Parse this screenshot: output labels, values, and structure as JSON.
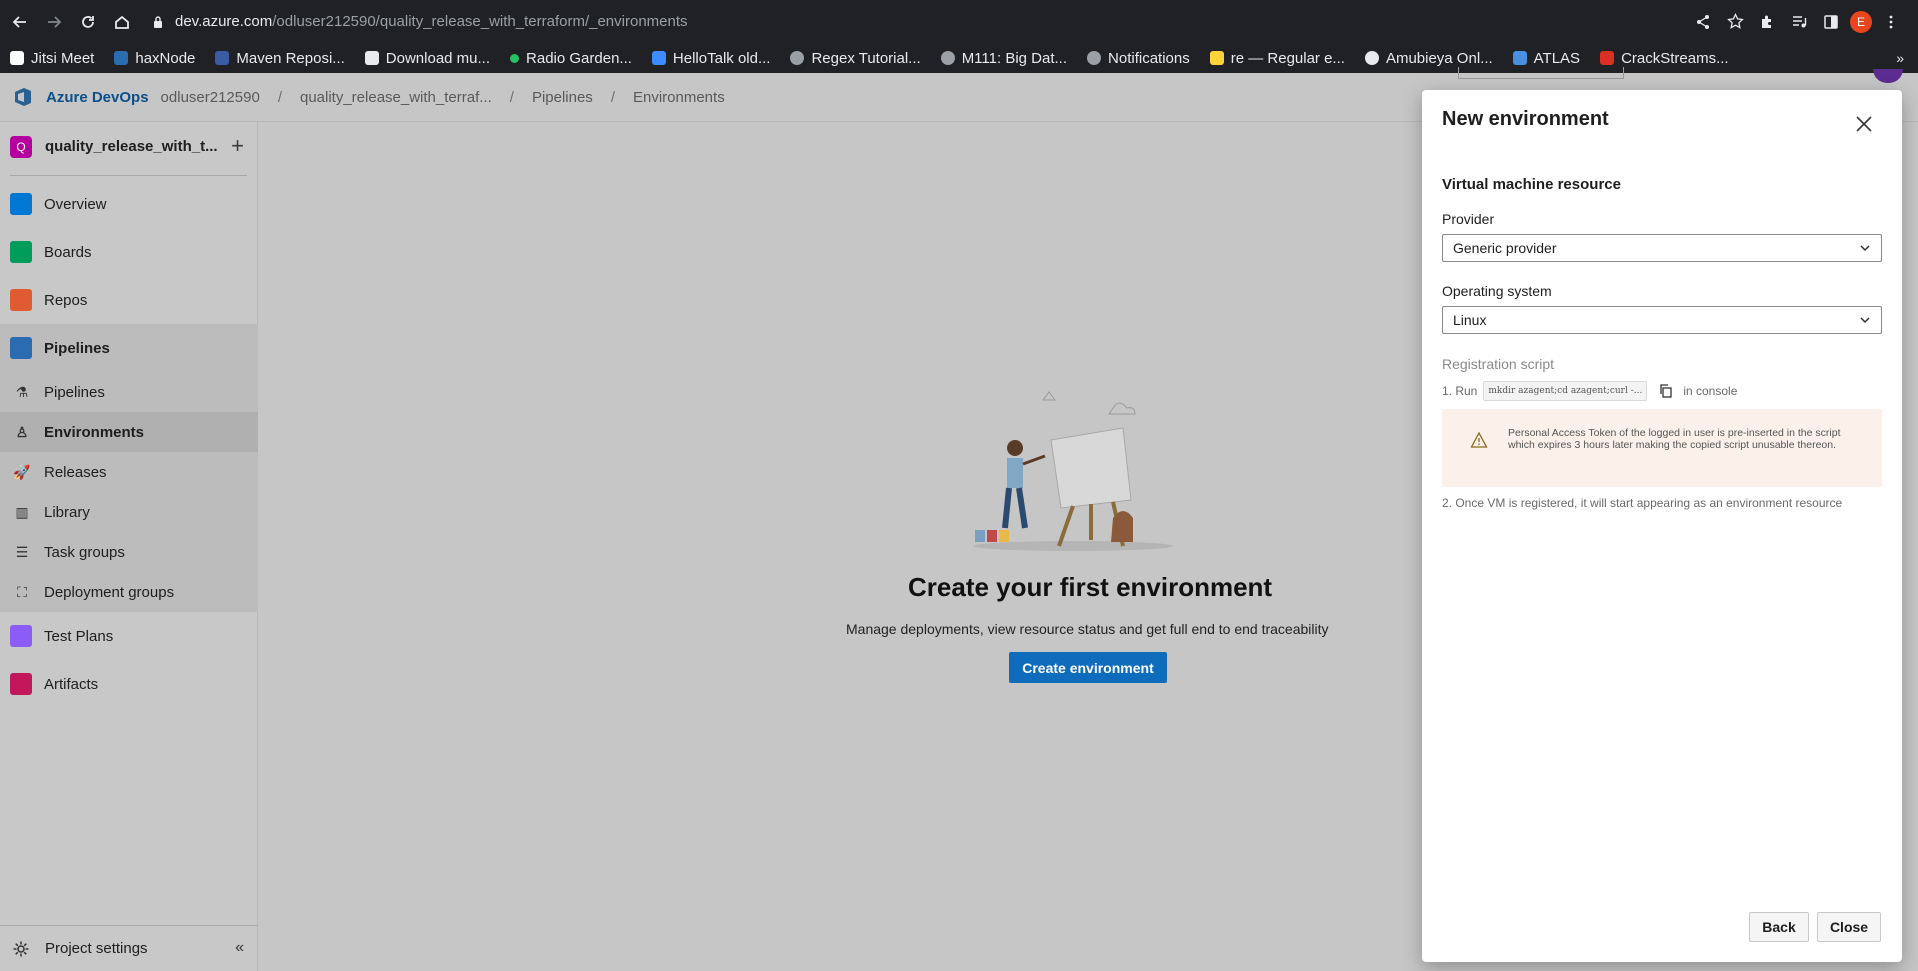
{
  "browser": {
    "url_host": "dev.azure.com",
    "url_path": "/odluser212590/quality_release_with_terraform/_environments",
    "profile_initial": "E",
    "bookmarks": [
      {
        "label": "Jitsi Meet",
        "color": "#ffffff"
      },
      {
        "label": "haxNode",
        "color": "#2b6cb0"
      },
      {
        "label": "Maven Reposi...",
        "color": "#3b5ba5"
      },
      {
        "label": "Download mu...",
        "color": "#e8eaed"
      },
      {
        "label": "Radio Garden...",
        "color": "#24c264"
      },
      {
        "label": "HelloTalk old...",
        "color": "#3d8bfd"
      },
      {
        "label": "Regex Tutorial...",
        "color": "#9aa0a6"
      },
      {
        "label": "M111: Big Dat...",
        "color": "#9aa0a6"
      },
      {
        "label": "Notifications",
        "color": "#9aa0a6"
      },
      {
        "label": "re — Regular e...",
        "color": "#ffd43b"
      },
      {
        "label": "Amubieya Onl...",
        "color": "#e8eaed"
      },
      {
        "label": "ATLAS",
        "color": "#4a90e2"
      },
      {
        "label": "CrackStreams...",
        "color": "#d93025"
      }
    ],
    "more_label": "»"
  },
  "topbar": {
    "brand": "Azure DevOps",
    "breadcrumbs": [
      "odluser212590",
      "quality_release_with_terraf...",
      "Pipelines",
      "Environments"
    ]
  },
  "sidebar": {
    "project_badge": "Q",
    "project_name": "quality_release_with_t...",
    "add_label": "+",
    "items": [
      {
        "label": "Overview",
        "icon": "overview-icon",
        "color": "#0078d4"
      },
      {
        "label": "Boards",
        "icon": "boards-icon",
        "color": "#009c5a"
      },
      {
        "label": "Repos",
        "icon": "repos-icon",
        "color": "#e05b31"
      }
    ],
    "pipelines_section": {
      "label": "Pipelines",
      "icon": "pipelines-icon",
      "color": "#2b6cb0"
    },
    "sub_items": [
      {
        "label": "Pipelines",
        "icon": "pipelines-sub-icon",
        "glyph": "⚗"
      },
      {
        "label": "Environments",
        "icon": "environments-icon",
        "glyph": "♙"
      },
      {
        "label": "Releases",
        "icon": "releases-icon",
        "glyph": "🚀"
      },
      {
        "label": "Library",
        "icon": "library-icon",
        "glyph": "▥"
      },
      {
        "label": "Task groups",
        "icon": "task-groups-icon",
        "glyph": "☰"
      },
      {
        "label": "Deployment groups",
        "icon": "deployment-groups-icon",
        "glyph": "⛶"
      }
    ],
    "bottom_items": [
      {
        "label": "Test Plans",
        "icon": "test-plans-icon",
        "color": "#8b5cf6"
      },
      {
        "label": "Artifacts",
        "icon": "artifacts-icon",
        "color": "#c2185b"
      }
    ],
    "settings_label": "Project settings",
    "collapse_glyph": "«"
  },
  "main": {
    "title": "Create your first environment",
    "subtitle": "Manage deployments, view resource status and get full end to end traceability",
    "cta_label": "Create environment"
  },
  "panel": {
    "title": "New environment",
    "section_title": "Virtual machine resource",
    "provider_label": "Provider",
    "provider_value": "Generic provider",
    "os_label": "Operating system",
    "os_value": "Linux",
    "registration_label": "Registration script",
    "step1_prefix": "1. Run",
    "step1_code": "mkdir azagent;cd azagent;curl -...",
    "step1_suffix": "in console",
    "warning_text": "Personal Access Token of the logged in user is pre-inserted in the script which expires 3 hours later making the copied script unusable thereon.",
    "step2": "2. Once VM is registered, it will start appearing as an environment resource",
    "back_label": "Back",
    "close_label": "Close"
  }
}
